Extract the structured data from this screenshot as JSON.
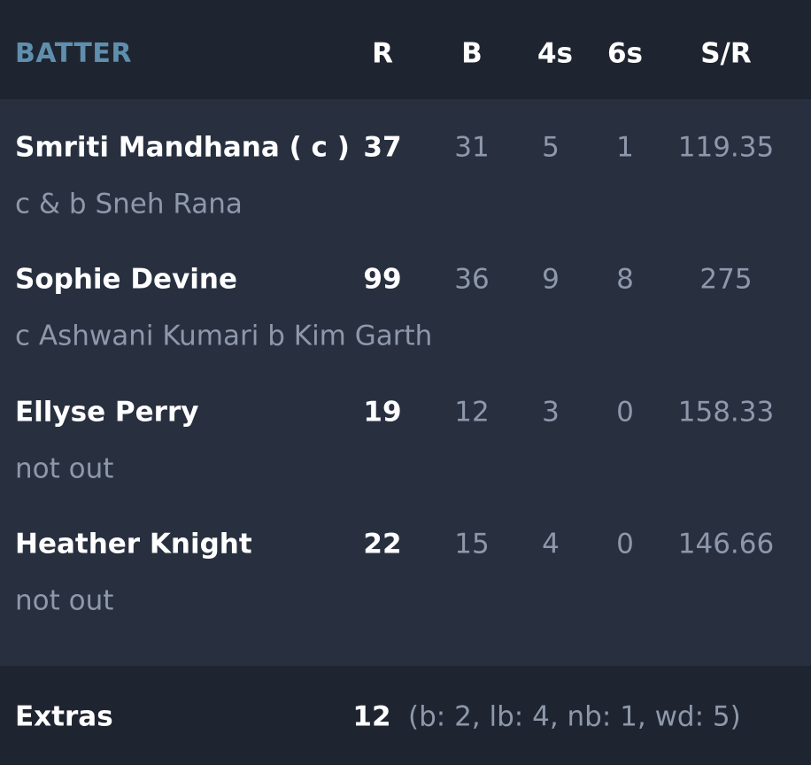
{
  "header": {
    "batter": "BATTER",
    "r": "R",
    "b": "B",
    "fours": "4s",
    "sixes": "6s",
    "sr": "S/R"
  },
  "batters": [
    {
      "name": "Smriti Mandhana ( c )",
      "dismissal": "c & b Sneh Rana",
      "r": "37",
      "b": "31",
      "fours": "5",
      "sixes": "1",
      "sr": "119.35"
    },
    {
      "name": "Sophie Devine",
      "dismissal": "c Ashwani Kumari b Kim Garth",
      "r": "99",
      "b": "36",
      "fours": "9",
      "sixes": "8",
      "sr": "275"
    },
    {
      "name": "Ellyse Perry",
      "dismissal": "not out",
      "r": "19",
      "b": "12",
      "fours": "3",
      "sixes": "0",
      "sr": "158.33"
    },
    {
      "name": "Heather Knight",
      "dismissal": "not out",
      "r": "22",
      "b": "15",
      "fours": "4",
      "sixes": "0",
      "sr": "146.66"
    }
  ],
  "extras": {
    "label": "Extras",
    "total": "12",
    "detail": "(b: 2, lb: 4, nb: 1, wd: 5)"
  },
  "colors": {
    "header_bg": "#1f2530",
    "body_bg": "#283040",
    "accent_label": "#5f8fae",
    "primary_text": "#ffffff",
    "muted_text": "#8e98ab"
  }
}
